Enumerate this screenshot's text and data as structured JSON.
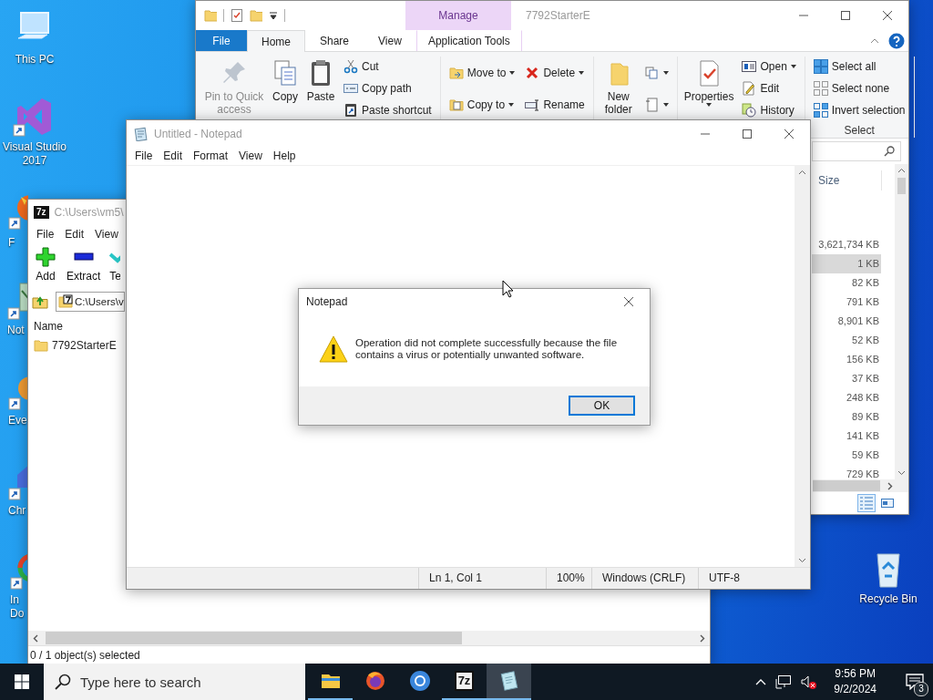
{
  "desktop": {
    "icons": [
      {
        "kind": "pc",
        "label": "This PC"
      },
      {
        "kind": "vs",
        "label": "Visual Studio 2017"
      },
      {
        "kind": "firefox",
        "label": "F"
      },
      {
        "kind": "notepad",
        "label": "Not"
      },
      {
        "kind": "orange",
        "label": "Eve"
      },
      {
        "kind": "blue",
        "label": "Chr"
      },
      {
        "kind": "rainbow",
        "label": "In Do"
      }
    ],
    "recycle_bin": {
      "label": "Recycle Bin"
    }
  },
  "explorer": {
    "title": "7792StarterE",
    "context_header": "Manage",
    "tabs": [
      {
        "kind": "file",
        "label": "File",
        "selected": false
      },
      {
        "kind": "normal",
        "label": "Home",
        "selected": true
      },
      {
        "kind": "normal",
        "label": "Share",
        "selected": false
      },
      {
        "kind": "normal",
        "label": "View",
        "selected": false
      },
      {
        "kind": "context",
        "label": "Application Tools",
        "selected": false
      }
    ],
    "ribbon": {
      "groups": [
        {
          "items": [
            {
              "kind": "large",
              "label": "Pin to Quick access",
              "disabled": true
            },
            {
              "kind": "large",
              "label": "Copy",
              "disabled": false
            },
            {
              "kind": "large",
              "label": "Paste",
              "disabled": false
            },
            {
              "kind": "stack",
              "items": [
                {
                  "label": "Cut"
                },
                {
                  "label": "Copy path"
                },
                {
                  "label": "Paste shortcut"
                }
              ]
            }
          ]
        },
        {
          "items": [
            {
              "kind": "stack",
              "items": [
                {
                  "label": "Move to",
                  "dropdown": true
                },
                {
                  "label": "Copy to",
                  "dropdown": true
                }
              ]
            },
            {
              "kind": "stack",
              "items": [
                {
                  "label": "Delete",
                  "dropdown": true
                },
                {
                  "label": "Rename"
                }
              ]
            }
          ]
        },
        {
          "items": [
            {
              "kind": "large",
              "label": "New folder",
              "disabled": false
            },
            {
              "kind": "stack",
              "items": [
                {
                  "dropdown": true
                },
                {
                  "dropdown": true
                }
              ]
            }
          ]
        },
        {
          "items": [
            {
              "kind": "large",
              "label": "Properties",
              "disabled": false,
              "dropdown": true
            },
            {
              "kind": "stack",
              "items": [
                {
                  "label": "Open",
                  "dropdown": true
                },
                {
                  "label": "Edit"
                },
                {
                  "label": "History"
                }
              ]
            }
          ]
        },
        {
          "label": "Select",
          "items": [
            {
              "kind": "stack",
              "items": [
                {
                  "label": "Select all"
                },
                {
                  "label": "Select none"
                },
                {
                  "label": "Invert selection"
                }
              ]
            }
          ]
        }
      ]
    },
    "file_list": {
      "column": "Size",
      "rows": [
        {
          "size": "3,621,734 KB",
          "selected": false
        },
        {
          "size": "1 KB",
          "selected": true
        },
        {
          "size": "82 KB",
          "selected": false
        },
        {
          "size": "791 KB",
          "selected": false
        },
        {
          "size": "8,901 KB",
          "selected": false
        },
        {
          "size": "52 KB",
          "selected": false
        },
        {
          "size": "156 KB",
          "selected": false
        },
        {
          "size": "37 KB",
          "selected": false
        },
        {
          "size": "248 KB",
          "selected": false
        },
        {
          "size": "89 KB",
          "selected": false
        },
        {
          "size": "141 KB",
          "selected": false
        },
        {
          "size": "59 KB",
          "selected": false
        },
        {
          "size": "729 KB",
          "selected": false
        }
      ]
    },
    "views": [
      {
        "kind": "details",
        "selected": true
      },
      {
        "kind": "tiles",
        "selected": false
      }
    ]
  },
  "sevenzip": {
    "logo": "7z",
    "title": "C:\\Users\\vm5\\",
    "menu": [
      "File",
      "Edit",
      "View"
    ],
    "toolbar": [
      {
        "kind": "add",
        "label": "Add"
      },
      {
        "kind": "extract",
        "label": "Extract"
      },
      {
        "kind": "test",
        "label": "Te"
      }
    ],
    "address": "C:\\Users\\v",
    "column": "Name",
    "rows": [
      {
        "name": "7792StarterE"
      }
    ],
    "status": "0 / 1 object(s) selected"
  },
  "notepad": {
    "title": "Untitled - Notepad",
    "menu": [
      "File",
      "Edit",
      "Format",
      "View",
      "Help"
    ],
    "status": [
      "Ln 1, Col 1",
      "100%",
      "Windows (CRLF)",
      "UTF-8"
    ]
  },
  "dialog": {
    "title": "Notepad",
    "message": "Operation did not complete successfully because the file contains a virus or potentially unwanted software.",
    "button": "OK"
  },
  "taskbar": {
    "search": {
      "placeholder": "Type here to search"
    },
    "apps": [
      {
        "kind": "explorer",
        "running": true,
        "selected": false
      },
      {
        "kind": "firefox",
        "running": false,
        "selected": false
      },
      {
        "kind": "chrome",
        "running": false,
        "selected": false
      },
      {
        "kind": "sevenzip",
        "label": "7z",
        "running": true,
        "selected": false
      },
      {
        "kind": "notepad",
        "running": true,
        "selected": true
      }
    ],
    "time": "9:56 PM",
    "date": "9/2/2024",
    "notifications": "3"
  }
}
